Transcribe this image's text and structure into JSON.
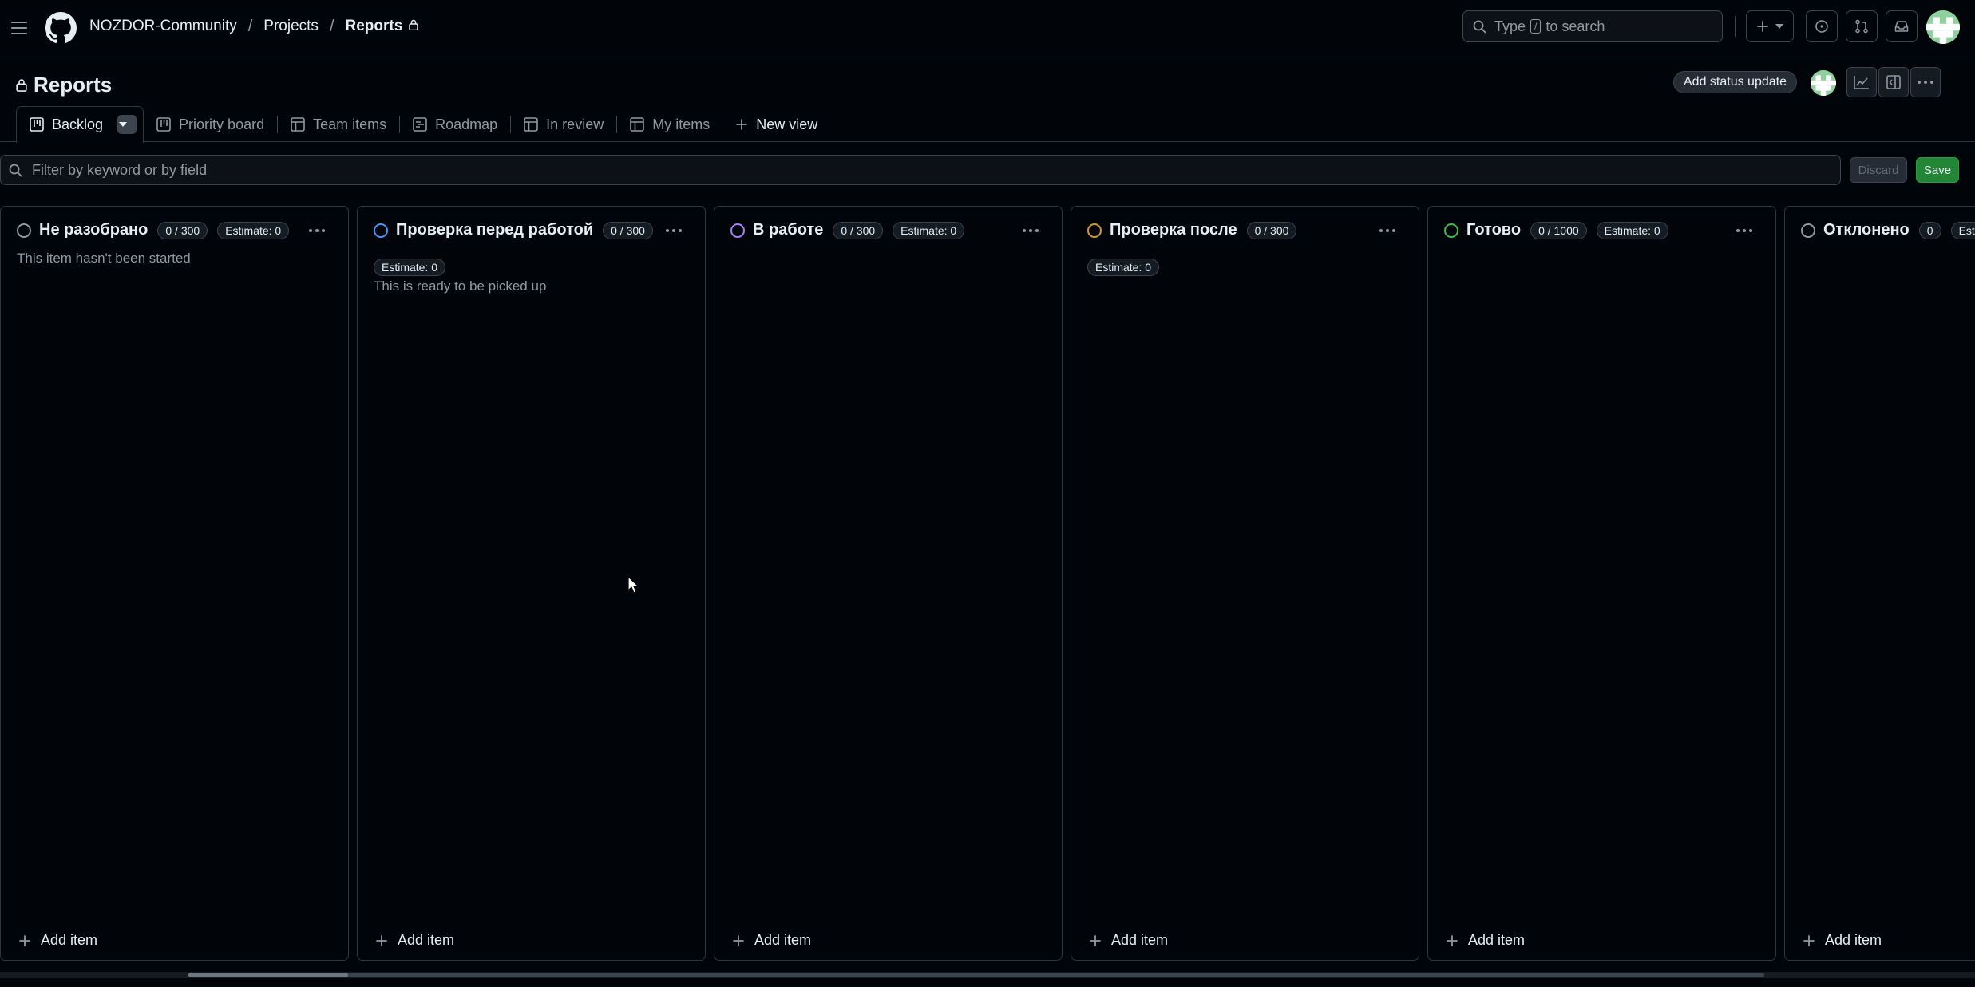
{
  "header": {
    "breadcrumb": {
      "org": "NOZDOR-Community",
      "projects": "Projects",
      "current": "Reports"
    },
    "search": {
      "prefix": "Type",
      "key": "/",
      "suffix": "to search"
    }
  },
  "project": {
    "title": "Reports",
    "add_status_label": "Add status update"
  },
  "tabs": [
    {
      "label": "Backlog",
      "icon": "board-icon"
    },
    {
      "label": "Priority board",
      "icon": "board-icon"
    },
    {
      "label": "Team items",
      "icon": "table-icon"
    },
    {
      "label": "Roadmap",
      "icon": "roadmap-icon"
    },
    {
      "label": "In review",
      "icon": "table-icon"
    },
    {
      "label": "My items",
      "icon": "table-icon"
    }
  ],
  "new_view_label": "New view",
  "filter": {
    "placeholder": "Filter by keyword or by field",
    "discard": "Discard",
    "save": "Save"
  },
  "columns": [
    {
      "name": "Не разобрано",
      "count": "0 / 300",
      "estimate": "Estimate: 0",
      "description": "This item hasn't been started",
      "color": "#9198a1",
      "add_label": "Add item"
    },
    {
      "name": "Проверка перед работой",
      "count": "0 / 300",
      "estimate": "Estimate: 0",
      "description": "This is ready to be picked up",
      "color": "#4493f8",
      "add_label": "Add item"
    },
    {
      "name": "В работе",
      "count": "0 / 300",
      "estimate": "Estimate: 0",
      "description": "",
      "color": "#ab7df8",
      "add_label": "Add item"
    },
    {
      "name": "Проверка после",
      "count": "0 / 300",
      "estimate": "Estimate: 0",
      "description": "",
      "color": "#d29922",
      "add_label": "Add item"
    },
    {
      "name": "Готово",
      "count": "0 / 1000",
      "estimate": "Estimate: 0",
      "description": "",
      "color": "#3fb950",
      "add_label": "Add item"
    },
    {
      "name": "Отклонено",
      "count": "0",
      "estimate": "Estim",
      "description": "",
      "color": "#9198a1",
      "add_label": "Add item"
    }
  ]
}
